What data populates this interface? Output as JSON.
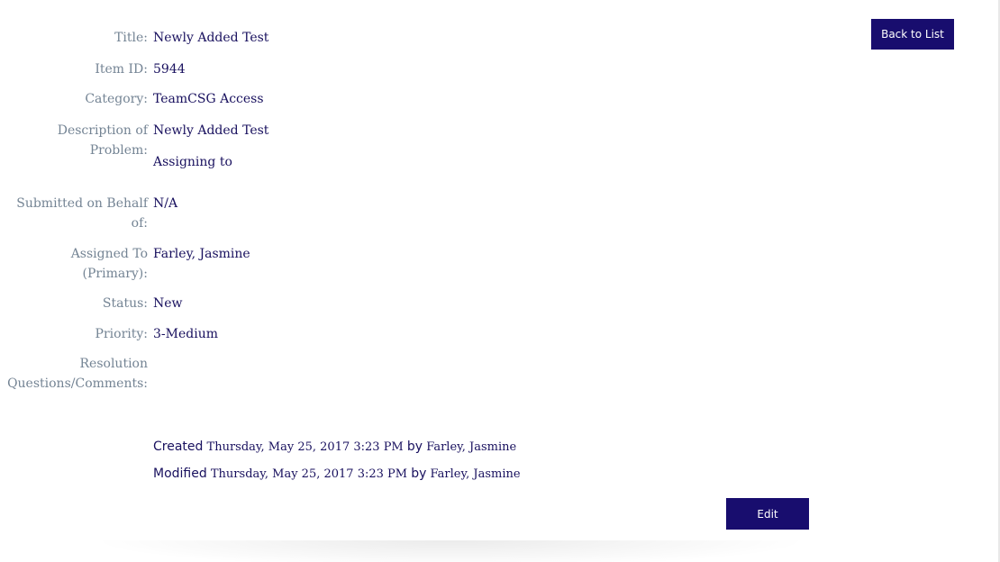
{
  "buttons": {
    "back_label": "Back to List",
    "edit_label": "Edit"
  },
  "fields": {
    "title": {
      "label": "Title:",
      "value": "Newly Added Test"
    },
    "item_id": {
      "label": "Item ID:",
      "value": "5944"
    },
    "category": {
      "label": "Category:",
      "value": "TeamCSG Access"
    },
    "description": {
      "label_line1": "Description of",
      "label_line2": "Problem:",
      "value_line1": "Newly Added Test",
      "value_line2": "Assigning to"
    },
    "submitted_on_behalf": {
      "label_line1": "Submitted on Behalf",
      "label_line2": "of:",
      "value": "N/A"
    },
    "assigned_to": {
      "label_line1": "Assigned To",
      "label_line2": "(Primary):",
      "value": "Farley, Jasmine"
    },
    "status": {
      "label": "Status:",
      "value": "New"
    },
    "priority": {
      "label": "Priority:",
      "value": "3-Medium"
    },
    "resolution": {
      "label_line1": "Resolution",
      "label_line2": "Questions/Comments:",
      "value": ""
    }
  },
  "audit": {
    "created_label": "Created",
    "created_date": "Thursday, May 25, 2017 3:23 PM",
    "created_by_label": "by",
    "created_by": "Farley, Jasmine",
    "modified_label": "Modified",
    "modified_date": "Thursday, May 25, 2017 3:23 PM",
    "modified_by_label": "by",
    "modified_by": "Farley, Jasmine"
  }
}
